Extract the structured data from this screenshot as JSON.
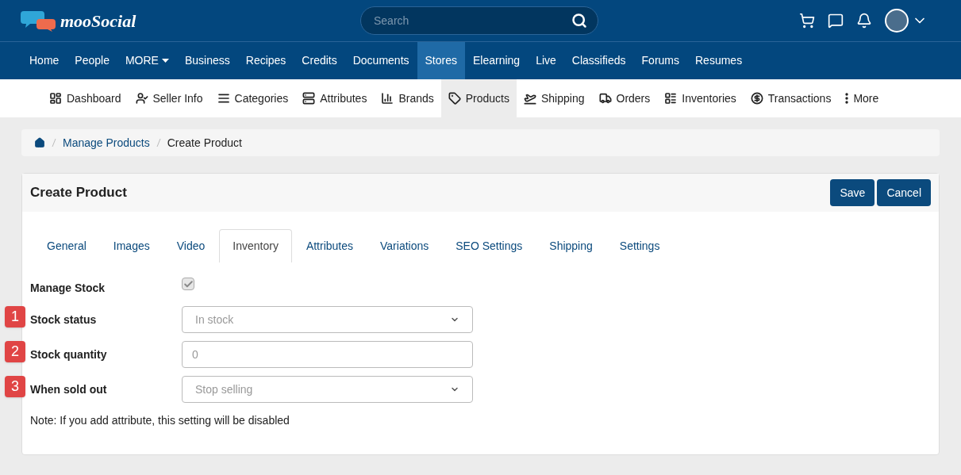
{
  "logo": {
    "text": "mooSocial"
  },
  "search": {
    "placeholder": "Search"
  },
  "nav": [
    {
      "label": "Home",
      "selected": false
    },
    {
      "label": "People",
      "selected": false
    },
    {
      "label": "MORE",
      "selected": false,
      "kind": "dropdown"
    },
    {
      "label": "Business",
      "selected": false
    },
    {
      "label": "Recipes",
      "selected": false
    },
    {
      "label": "Credits",
      "selected": false
    },
    {
      "label": "Documents",
      "selected": false
    },
    {
      "label": "Stores",
      "selected": true
    },
    {
      "label": "Elearning",
      "selected": false
    },
    {
      "label": "Live",
      "selected": false
    },
    {
      "label": "Classifieds",
      "selected": false
    },
    {
      "label": "Forums",
      "selected": false
    },
    {
      "label": "Resumes",
      "selected": false
    }
  ],
  "subnav": [
    {
      "label": "Dashboard",
      "kind": "dashboard",
      "selected": false
    },
    {
      "label": "Seller Info",
      "kind": "seller",
      "selected": false
    },
    {
      "label": "Categories",
      "kind": "categories",
      "selected": false
    },
    {
      "label": "Attributes",
      "kind": "attributes",
      "selected": false
    },
    {
      "label": "Brands",
      "kind": "brands",
      "selected": false
    },
    {
      "label": "Products",
      "kind": "products",
      "selected": true
    },
    {
      "label": "Shipping",
      "kind": "shipping",
      "selected": false
    },
    {
      "label": "Orders",
      "kind": "orders",
      "selected": false
    },
    {
      "label": "Inventories",
      "kind": "inventories",
      "selected": false
    },
    {
      "label": "Transactions",
      "kind": "transactions",
      "selected": false
    },
    {
      "label": "More",
      "kind": "more",
      "selected": false
    }
  ],
  "breadcrumb": [
    "Manage Products",
    "Create Product"
  ],
  "card": {
    "title": "Create Product",
    "buttons": [
      "Save",
      "Cancel"
    ]
  },
  "tabs": [
    {
      "label": "General",
      "selected": false
    },
    {
      "label": "Images",
      "selected": false
    },
    {
      "label": "Video",
      "selected": false
    },
    {
      "label": "Inventory",
      "selected": true
    },
    {
      "label": "Attributes",
      "selected": false
    },
    {
      "label": "Variations",
      "selected": false
    },
    {
      "label": "SEO Settings",
      "selected": false
    },
    {
      "label": "Shipping",
      "selected": false
    },
    {
      "label": "Settings",
      "selected": false
    }
  ],
  "fields": [
    {
      "label": "Manage Stock",
      "kind": "checkbox",
      "checked": true,
      "disabled": true
    },
    {
      "label": "Stock status",
      "kind": "select",
      "value": "In stock",
      "marker": "1"
    },
    {
      "label": "Stock quantity",
      "kind": "input",
      "placeholder": "0",
      "marker": "2"
    },
    {
      "label": "When sold out",
      "kind": "select",
      "value": "Stop selling",
      "marker": "3"
    }
  ],
  "note": "Note: If you add attribute, this setting will be disabled"
}
